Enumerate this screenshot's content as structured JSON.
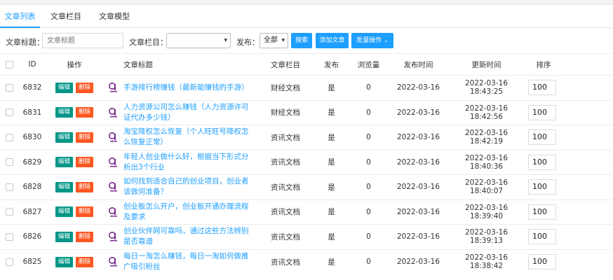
{
  "tabs": [
    "文章列表",
    "文章栏目",
    "文章模型"
  ],
  "search": {
    "title_label": "文章标题：",
    "title_placeholder": "文章标题",
    "column_label": "文章栏目：",
    "column_value": "",
    "publish_label": "发布：",
    "publish_value": "全部",
    "search_button": "搜索",
    "add_button": "添加文章",
    "batch_button": "批量操作"
  },
  "table": {
    "headers": [
      "ID",
      "操作",
      "文章标题",
      "文章栏目",
      "发布",
      "浏览量",
      "发布时间",
      "更新时间",
      "排序"
    ],
    "edit_label": "编辑",
    "delete_label": "删除",
    "rows": [
      {
        "id": "6832",
        "title": "手游排行榜赚钱（最新能赚钱的手游）",
        "column": "财经文档",
        "published": "是",
        "views": "0",
        "pub_time": "2022-03-16",
        "upd_time": "2022-03-16 18:43:25",
        "sort": "100"
      },
      {
        "id": "6831",
        "title": "人力资源公司怎么赚钱（人力资源许可证代办多少钱）",
        "column": "财经文档",
        "published": "是",
        "views": "0",
        "pub_time": "2022-03-16",
        "upd_time": "2022-03-16 18:42:56",
        "sort": "100"
      },
      {
        "id": "6830",
        "title": "淘宝降权怎么恢复（个人旺旺号降权怎么恢复正常）",
        "column": "资讯文档",
        "published": "是",
        "views": "0",
        "pub_time": "2022-03-16",
        "upd_time": "2022-03-16 18:42:19",
        "sort": "100"
      },
      {
        "id": "6829",
        "title": "年轻人创业做什么好，根据当下形式分析出3个行业",
        "column": "资讯文档",
        "published": "是",
        "views": "0",
        "pub_time": "2022-03-16",
        "upd_time": "2022-03-16 18:40:36",
        "sort": "100"
      },
      {
        "id": "6828",
        "title": "如何找到适合自己的创业项目，创业者该做何准备？",
        "column": "资讯文档",
        "published": "是",
        "views": "0",
        "pub_time": "2022-03-16",
        "upd_time": "2022-03-16 18:40:07",
        "sort": "100"
      },
      {
        "id": "6827",
        "title": "创业板怎么开户，创业板开通办理流程及要求",
        "column": "资讯文档",
        "published": "是",
        "views": "0",
        "pub_time": "2022-03-16",
        "upd_time": "2022-03-16 18:39:40",
        "sort": "100"
      },
      {
        "id": "6826",
        "title": "创业伙伴网可靠吗，通过这些方法辨别是否靠谱",
        "column": "资讯文档",
        "published": "是",
        "views": "0",
        "pub_time": "2022-03-16",
        "upd_time": "2022-03-16 18:39:13",
        "sort": "100"
      },
      {
        "id": "6825",
        "title": "每日一淘怎么赚钱，每日一淘如何做推广吸引粉丝",
        "column": "资讯文档",
        "published": "是",
        "views": "0",
        "pub_time": "2022-03-16",
        "upd_time": "2022-03-16 18:38:42",
        "sort": "100"
      }
    ]
  }
}
